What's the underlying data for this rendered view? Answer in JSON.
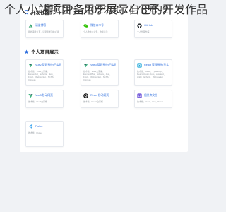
{
  "sections": {
    "community": {
      "title": "开发社区",
      "icon": "bookmark-icon"
    },
    "projects": {
      "title": "个人项目展示",
      "icon": "star-icon"
    }
  },
  "community_cards": [
    {
      "title": "语雀博客",
      "desc": "我的语雀主页，记录我学习的点滴",
      "icon": "yuque-icon",
      "color": "#2f9e6a"
    },
    {
      "title": "微信公众号",
      "desc": "个人微信公众号，欢迎关注",
      "icon": "wechat-icon",
      "color": "#2dc100"
    },
    {
      "title": "GitHub",
      "desc": "个人代码仓库",
      "icon": "github-icon",
      "color": "#24292e"
    }
  ],
  "project_cards": [
    {
      "title": "Vue2 管理系统(已实现CI/CD)",
      "desc": "技术栈：Vue2全家桶、ElementUI、Echarts、Jest、Fetch、WebSocket、SCSS、Cypress",
      "icon": "vue-icon",
      "color": "#42b883"
    },
    {
      "title": "Vue3 管理系统(已实现CI/CD)",
      "desc": "技术栈：Vue3全家桶、ElementPlus、Echarts、Jest、Fetch、WebSocket、SCSS、Cypress",
      "icon": "vue-icon",
      "color": "#42b883"
    },
    {
      "title": "React 管理系统(已实现CI/CD)",
      "desc": "技术栈：React、TypeScript、React-Router-Dom、Zustand、AntD、Echarts、WebSocket",
      "icon": "react-icon",
      "color": "#1aa6d8"
    },
    {
      "title": "Vue3 移动网页",
      "desc": "技术栈：Vue3全家桶",
      "icon": "vue-icon",
      "color": "#42b883"
    },
    {
      "title": "React 移动网页",
      "desc": "技术栈：React全家桶",
      "icon": "react-icon",
      "color": "#111111"
    },
    {
      "title": "组件库文档",
      "desc": "技术栈：Dumi、Umi、React",
      "icon": "component-lib-icon",
      "color": "#6b4fd8"
    },
    {
      "title": "Flutter",
      "desc": "技术栈：Flutter",
      "icon": "flutter-icon",
      "color": "#3ea6f0"
    }
  ],
  "footer": {
    "line1": "个人小站项目，用于展示自己的开发作品",
    "line2": "粤ICP备2022007478号-2"
  },
  "colors": {
    "accent": "#2f6fde",
    "background": "#f0f2f5"
  }
}
